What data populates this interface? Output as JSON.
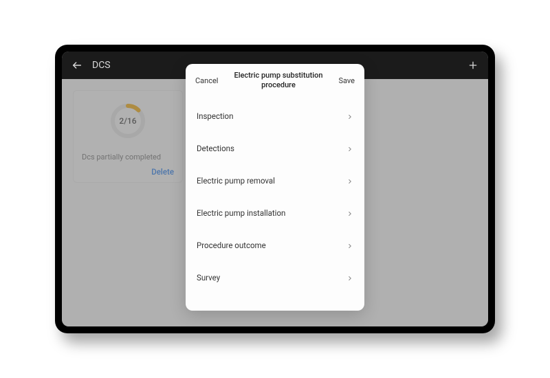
{
  "topbar": {
    "title": "DCS"
  },
  "card": {
    "progress_current": 2,
    "progress_total": 16,
    "progress_label": "2/16",
    "status": "Dcs partially completed",
    "delete_label": "Delete"
  },
  "modal": {
    "cancel_label": "Cancel",
    "save_label": "Save",
    "title": "Electric pump substitution procedure",
    "items": [
      {
        "label": "Inspection"
      },
      {
        "label": "Detections"
      },
      {
        "label": "Electric pump removal"
      },
      {
        "label": "Electric pump installation"
      },
      {
        "label": "Procedure outcome"
      },
      {
        "label": "Survey"
      }
    ]
  }
}
